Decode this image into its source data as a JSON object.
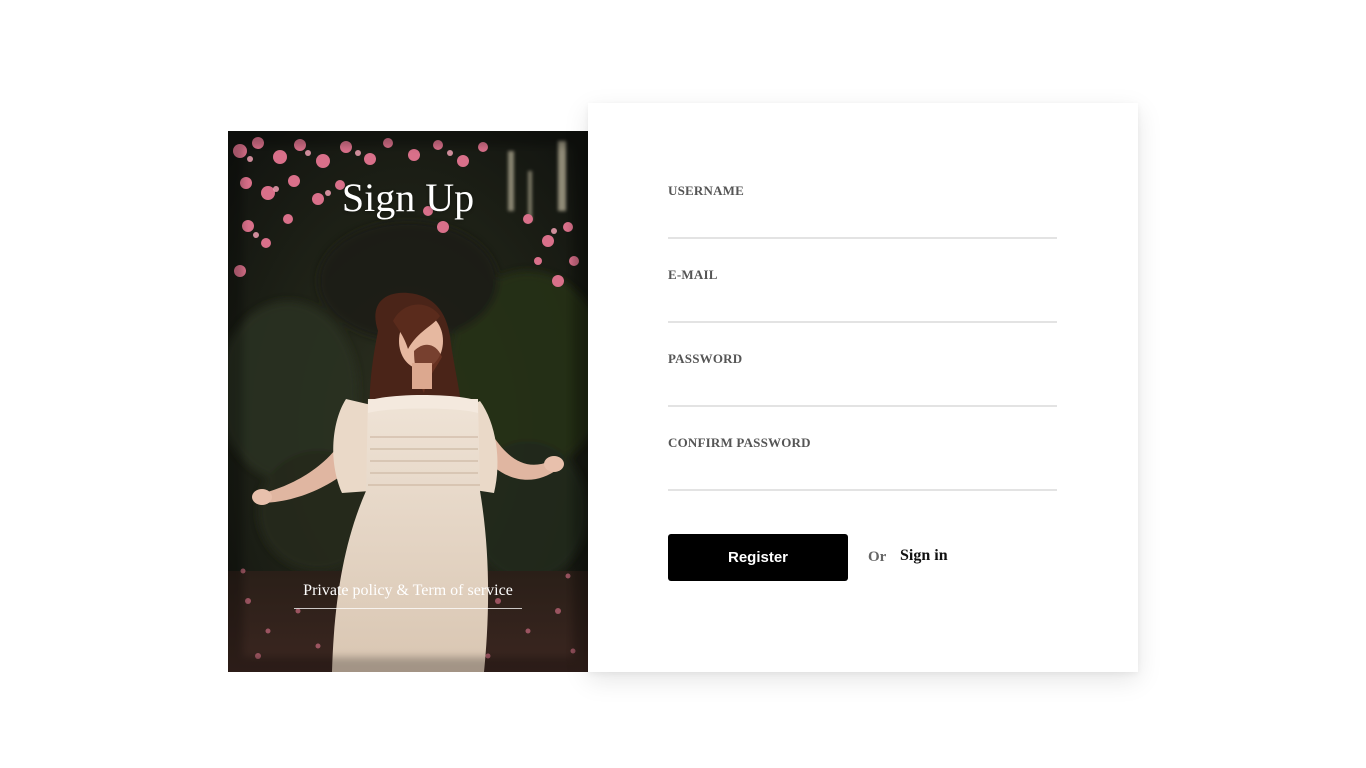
{
  "hero": {
    "title": "Sign Up",
    "policy_link": "Private policy & Term of service"
  },
  "form": {
    "fields": [
      {
        "label": "USERNAME",
        "value": ""
      },
      {
        "label": "E-MAIL",
        "value": ""
      },
      {
        "label": "PASSWORD",
        "value": ""
      },
      {
        "label": "CONFIRM PASSWORD",
        "value": ""
      }
    ],
    "register_label": "Register",
    "or_text": "Or",
    "signin_label": "Sign in"
  },
  "colors": {
    "button_bg": "#000000",
    "button_text": "#ffffff",
    "label": "#555555",
    "underline": "#e3e3e3"
  }
}
